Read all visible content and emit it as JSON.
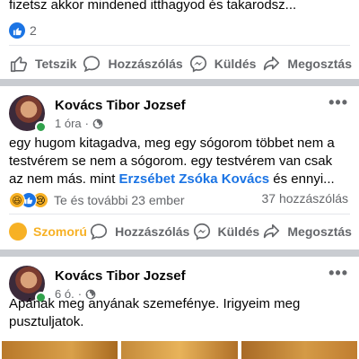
{
  "post1": {
    "text_tail": "fizetsz akkor mindened itthagyod és takarodsz...",
    "reaction_count": "2",
    "actions": {
      "like": "Tetszik",
      "comment": "Hozzászólás",
      "send": "Küldés",
      "share": "Megosztás"
    }
  },
  "post2": {
    "author": "Kovács Tibor Jozsef",
    "time": "1 óra",
    "audience_icon": "globe-icon",
    "text_before": "egy hugom kitagadva, meg egy sógorom többet nem a testvérem se nem a sógorom. egy testvérem van csak az nem más. mint ",
    "mention": "Erzsébet Zsóka Kovács",
    "text_after": " és ennyi...",
    "reactions_summary": "Te és további 23 ember",
    "comments_count": "37 hozzászólás",
    "actions": {
      "react": "Szomorú",
      "comment": "Hozzászólás",
      "send": "Küldés",
      "share": "Megosztás"
    }
  },
  "post3": {
    "author": "Kovács Tibor Jozsef",
    "time": "6 ó.",
    "audience_icon": "globe-icon",
    "text": "Apának meg anyának szemefénye. Irigyeim meg pusztuljatok."
  },
  "colors": {
    "accent": "#1b74e4",
    "sad": "#f7b125",
    "online": "#31a24c",
    "muted": "#65676b",
    "separator": "#c9ccd1"
  }
}
